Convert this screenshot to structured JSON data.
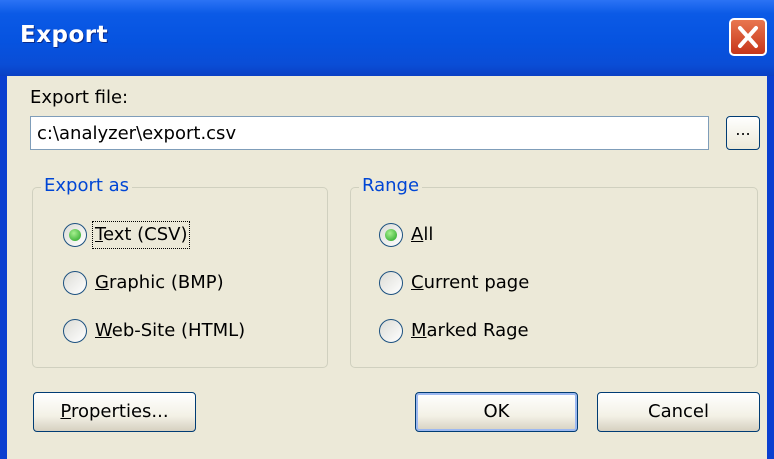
{
  "window": {
    "title": "Export",
    "close_label": "X"
  },
  "export_file": {
    "label": "Export file:",
    "value": "c:\\analyzer\\export.csv",
    "browse_label": "..."
  },
  "export_as": {
    "legend": "Export as",
    "options": [
      {
        "pre": "",
        "key": "T",
        "rest": "ext (CSV)",
        "selected": true
      },
      {
        "pre": "",
        "key": "G",
        "rest": "raphic (BMP)",
        "selected": false
      },
      {
        "pre": "",
        "key": "W",
        "rest": "eb-Site (HTML)",
        "selected": false
      }
    ]
  },
  "range": {
    "legend": "Range",
    "options": [
      {
        "pre": "",
        "key": "A",
        "rest": "ll",
        "selected": true
      },
      {
        "pre": "",
        "key": "C",
        "rest": "urrent page",
        "selected": false
      },
      {
        "pre": "",
        "key": "M",
        "rest": "arked Rage",
        "selected": false
      }
    ]
  },
  "buttons": {
    "properties_key": "P",
    "properties_rest": "roperties...",
    "ok": "OK",
    "cancel": "Cancel"
  },
  "colors": {
    "titlebar": "#0653e0",
    "dialog_bg": "#ece9d8",
    "group_legend": "#0046d5",
    "radio_selected": "#21a121",
    "close_button": "#c6361b"
  }
}
